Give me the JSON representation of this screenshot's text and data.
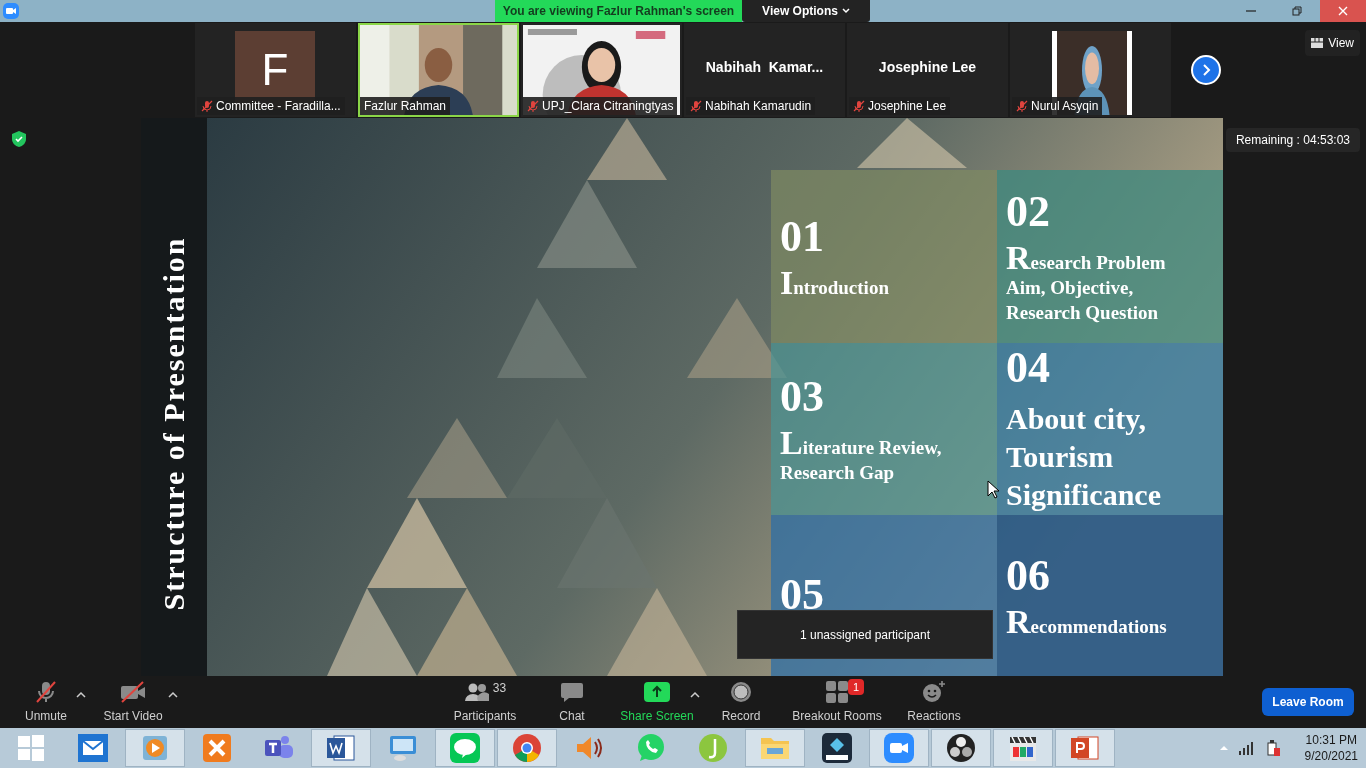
{
  "title_bar": {
    "banner": "You are viewing Fazlur Rahman's screen",
    "view_options": "View Options"
  },
  "participants": [
    {
      "kind": "avatar",
      "initial": "F",
      "name": "Committee - Faradilla...",
      "muted": true,
      "speaking": false
    },
    {
      "kind": "video",
      "name": "Fazlur Rahman",
      "muted": false,
      "speaking": true
    },
    {
      "kind": "video",
      "name": "UPJ_Clara Citraningtyas",
      "muted": true,
      "speaking": false
    },
    {
      "kind": "name",
      "display": "Nabihah  Kamar...",
      "name": "Nabihah Kamarudin",
      "muted": true,
      "speaking": false
    },
    {
      "kind": "name",
      "display": "Josephine Lee",
      "name": "Josephine Lee",
      "muted": true,
      "speaking": false
    },
    {
      "kind": "narrow_video",
      "name": "Nurul Asyqin",
      "muted": true,
      "speaking": false
    }
  ],
  "view_button": "View",
  "remaining": "Remaining : 04:53:03",
  "slide": {
    "side_title": "Structure of Presentation",
    "items": [
      {
        "number": "01",
        "kind": "dropcap",
        "lines": [
          "Introduction"
        ]
      },
      {
        "number": "02",
        "kind": "dropcap",
        "lines": [
          "Research Problem",
          "Aim, Objective,",
          "Research Question"
        ]
      },
      {
        "number": "03",
        "kind": "dropcap",
        "lines": [
          "Literature Review,",
          "Research Gap"
        ]
      },
      {
        "number": "04",
        "kind": "large",
        "lines": [
          "About city,",
          "Tourism",
          "Significance"
        ]
      },
      {
        "number": "05"
      },
      {
        "number": "06",
        "kind": "dropcap",
        "lines": [
          "Recommendations"
        ]
      }
    ]
  },
  "tooltip": "1 unassigned participant",
  "toolbar": {
    "items": [
      {
        "kind": "mic",
        "label": "Unmute",
        "caret": true
      },
      {
        "kind": "camera",
        "label": "Start Video",
        "caret": true
      },
      {
        "kind": "participants",
        "label": "Participants",
        "count": "33",
        "caret": false
      },
      {
        "kind": "chat",
        "label": "Chat",
        "caret": false
      },
      {
        "kind": "share",
        "label": "Share Screen",
        "caret": true
      },
      {
        "kind": "record",
        "label": "Record",
        "caret": false
      },
      {
        "kind": "breakout",
        "label": "Breakout Rooms",
        "badge": "1",
        "caret": false
      },
      {
        "kind": "reactions",
        "label": "Reactions",
        "caret": false
      }
    ],
    "leave": "Leave Room"
  },
  "taskbar": {
    "apps": [
      {
        "kind": "windows",
        "running": false
      },
      {
        "kind": "mail",
        "running": false
      },
      {
        "kind": "player",
        "running": true
      },
      {
        "kind": "xampp",
        "running": false
      },
      {
        "kind": "teams",
        "running": false
      },
      {
        "kind": "word",
        "running": true
      },
      {
        "kind": "remote",
        "running": false
      },
      {
        "kind": "line",
        "running": true
      },
      {
        "kind": "chrome",
        "running": true
      },
      {
        "kind": "speaker",
        "running": false
      },
      {
        "kind": "whatsapp",
        "running": false
      },
      {
        "kind": "j",
        "running": false
      },
      {
        "kind": "explorer",
        "running": true
      },
      {
        "kind": "filmora",
        "running": false
      },
      {
        "kind": "zoom",
        "running": true
      },
      {
        "kind": "obs",
        "running": true
      },
      {
        "kind": "counter",
        "running": true
      },
      {
        "kind": "powerpoint",
        "running": true
      }
    ],
    "time": "10:31 PM",
    "date": "9/20/2021"
  }
}
